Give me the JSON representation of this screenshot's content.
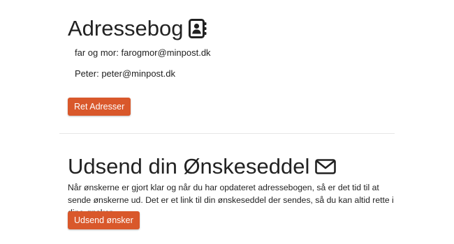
{
  "addressbook": {
    "title": "Adressebog",
    "icon": "address-book-icon",
    "entries": [
      {
        "name": "far og mor",
        "email": "farogmor@minpost.dk"
      },
      {
        "name": "Peter",
        "email": "peter@minpost.dk"
      }
    ],
    "edit_button_label": "Ret Adresser"
  },
  "send": {
    "title": "Udsend din Ønskeseddel",
    "icon": "envelope-icon",
    "description": "Når ønskerne er gjort klar og når du har opdateret adressebogen, så er det tid til at sende ønskerne ud. Det er et link til din ønskeseddel der sendes, så du kan altid rette i dine ønsker.",
    "send_button_label": "Udsend ønsker"
  },
  "colors": {
    "button_bg": "#d9582b",
    "button_text": "#ffffff",
    "text": "#222222",
    "divider": "#e6e6e6"
  }
}
